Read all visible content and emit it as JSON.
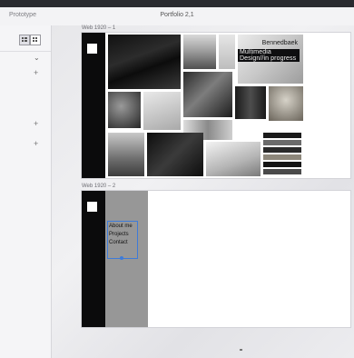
{
  "toolbar": {
    "mode_label": "Prototype",
    "document_title": "Portfolio 2,1"
  },
  "sidebar": {
    "view_toggle": [
      "list-view-icon",
      "grid-view-icon"
    ],
    "chevron_icon": "chevron-down-icon",
    "plus_icon": "plus-icon"
  },
  "frames": [
    {
      "label": "Web 1920 – 1",
      "hero_name": "Bennedbaek",
      "hero_subtitle": "Multimedia Design//in progress"
    },
    {
      "label": "Web 1920 – 2",
      "nav": [
        "About me",
        "Projects",
        "Contact"
      ]
    }
  ],
  "colors": {
    "selection_accent": "#3e7bd8",
    "frame_dark": "#0b0b0c",
    "frame_gray": "#979797"
  }
}
